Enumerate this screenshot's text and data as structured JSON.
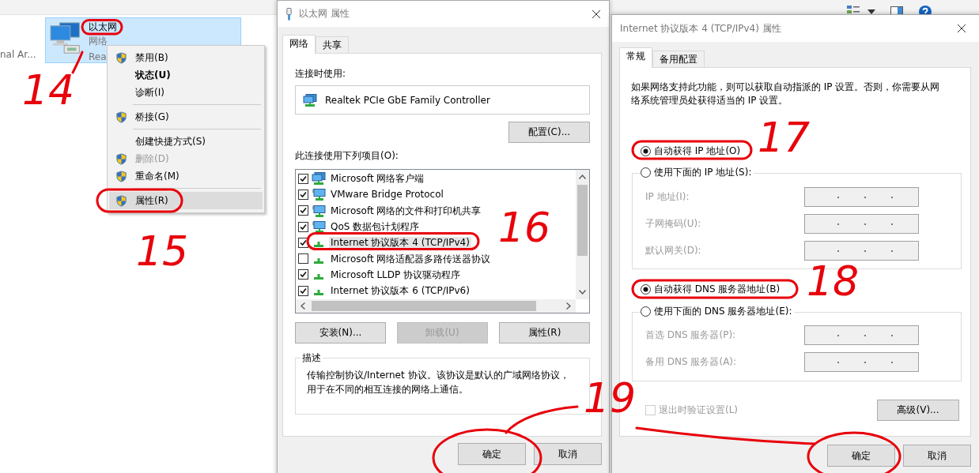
{
  "explorer": {
    "left_item": "nal Ar...",
    "adapter": {
      "name": "以太网",
      "subtitle": "网络",
      "device": "Rea",
      "selected": true
    }
  },
  "context_menu": {
    "items": [
      {
        "kind": "item",
        "label": "禁用(B)",
        "shield": true,
        "bold": false,
        "disabled": false,
        "selected": false
      },
      {
        "kind": "item",
        "label": "状态(U)",
        "shield": false,
        "bold": true,
        "disabled": false,
        "selected": false
      },
      {
        "kind": "item",
        "label": "诊断(I)",
        "shield": false,
        "bold": false,
        "disabled": false,
        "selected": false
      },
      {
        "kind": "separator"
      },
      {
        "kind": "item",
        "label": "桥接(G)",
        "shield": true,
        "bold": false,
        "disabled": false,
        "selected": false
      },
      {
        "kind": "separator"
      },
      {
        "kind": "item",
        "label": "创建快捷方式(S)",
        "shield": false,
        "bold": false,
        "disabled": false,
        "selected": false
      },
      {
        "kind": "item",
        "label": "删除(D)",
        "shield": true,
        "bold": false,
        "disabled": true,
        "selected": false
      },
      {
        "kind": "item",
        "label": "重命名(M)",
        "shield": true,
        "bold": false,
        "disabled": false,
        "selected": false
      },
      {
        "kind": "separator"
      },
      {
        "kind": "item",
        "label": "属性(R)",
        "shield": true,
        "bold": false,
        "disabled": false,
        "selected": true
      }
    ]
  },
  "adapter_dialog": {
    "title": "以太网 属性",
    "tabs": [
      {
        "label": "网络",
        "selected": true
      },
      {
        "label": "共享",
        "selected": false
      }
    ],
    "connect_using_label": "连接时使用:",
    "adapter": "Realtek PCIe GbE Family Controller",
    "configure_button": "配置(C)...",
    "items_label": "此连接使用下列项目(O):",
    "items": [
      {
        "label": "Microsoft 网络客户端",
        "kind": "client",
        "checked": true,
        "selected": false
      },
      {
        "label": "VMware Bridge Protocol",
        "kind": "service",
        "checked": true,
        "selected": false
      },
      {
        "label": "Microsoft 网络的文件和打印机共享",
        "kind": "service",
        "checked": true,
        "selected": false
      },
      {
        "label": "QoS 数据包计划程序",
        "kind": "service",
        "checked": true,
        "selected": false
      },
      {
        "label": "Internet 协议版本 4 (TCP/IPv4)",
        "kind": "protocol",
        "checked": true,
        "selected": true
      },
      {
        "label": "Microsoft 网络适配器多路传送器协议",
        "kind": "protocol",
        "checked": false,
        "selected": false
      },
      {
        "label": "Microsoft LLDP 协议驱动程序",
        "kind": "protocol",
        "checked": true,
        "selected": false
      },
      {
        "label": "Internet 协议版本 6 (TCP/IPv6)",
        "kind": "protocol",
        "checked": true,
        "selected": false
      }
    ],
    "buttons": [
      {
        "label": "安装(N)...",
        "disabled": false
      },
      {
        "label": "卸载(U)",
        "disabled": true
      },
      {
        "label": "属性(R)",
        "disabled": false
      }
    ],
    "description": {
      "title": "描述",
      "text": "传输控制协议/Internet 协议。该协议是默认的广域网络协议，用于在不同的相互连接的网络上通信。"
    },
    "footer_buttons": [
      "确定",
      "取消"
    ]
  },
  "ipv4_dialog": {
    "title": "Internet 协议版本 4 (TCP/IPv4) 属性",
    "tabs": [
      {
        "label": "常规",
        "selected": true
      },
      {
        "label": "备用配置",
        "selected": false
      }
    ],
    "intro": "如果网络支持此功能，则可以获取自动指派的 IP 设置。否则，你需要从网络系统管理员处获得适当的 IP 设置。",
    "ip_options": [
      {
        "label": "自动获得 IP 地址(O)",
        "selected": true
      },
      {
        "label": "使用下面的 IP 地址(S):",
        "selected": false
      }
    ],
    "ip_fields": [
      {
        "label": "IP 地址(I):",
        "disabled": true
      },
      {
        "label": "子网掩码(U):",
        "disabled": true
      },
      {
        "label": "默认网关(D):",
        "disabled": true
      }
    ],
    "dns_options": [
      {
        "label": "自动获得 DNS 服务器地址(B)",
        "selected": true
      },
      {
        "label": "使用下面的 DNS 服务器地址(E):",
        "selected": false
      }
    ],
    "dns_fields": [
      {
        "label": "首选 DNS 服务器(P):",
        "disabled": true
      },
      {
        "label": "备用 DNS 服务器(A):",
        "disabled": true
      }
    ],
    "validate": {
      "label": "退出时验证设置(L)",
      "checked": false,
      "disabled": true
    },
    "advanced_button": "高级(V)...",
    "footer_buttons": [
      "确定",
      "取消"
    ]
  },
  "annotations": [
    {
      "text": "14"
    },
    {
      "text": "15"
    },
    {
      "text": "16"
    },
    {
      "text": "17"
    },
    {
      "text": "18"
    },
    {
      "text": "19"
    }
  ]
}
